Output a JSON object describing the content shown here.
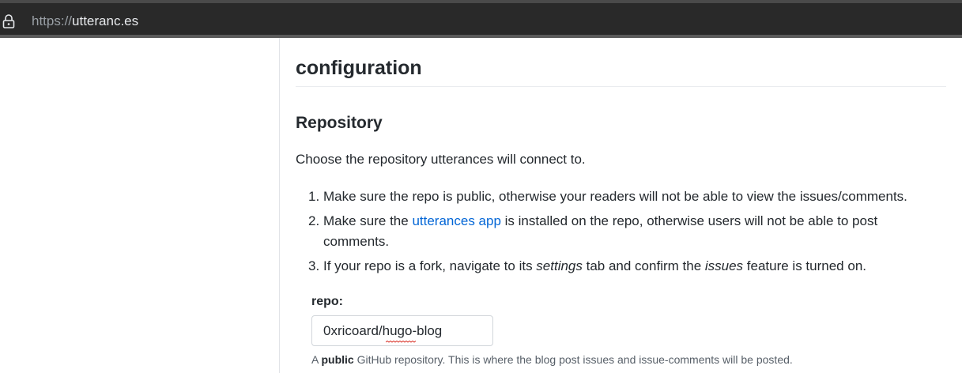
{
  "browser": {
    "url_scheme": "https://",
    "url_host": "utteranc.es"
  },
  "page": {
    "title": "configuration",
    "section_title": "Repository",
    "intro": "Choose the repository utterances will connect to.",
    "steps": [
      {
        "number": "1.",
        "text": "Make sure the repo is public, otherwise your readers will not be able to view the issues/comments."
      },
      {
        "number": "2.",
        "before": "Make sure the ",
        "link": "utterances app",
        "after": " is installed on the repo, otherwise users will not be able to post comments."
      },
      {
        "number": "3.",
        "before": "If your repo is a fork, navigate to its ",
        "em1": "settings",
        "middle": " tab and confirm the ",
        "em2": "issues",
        "after": " feature is turned on."
      }
    ],
    "repo_field": {
      "label": "repo:",
      "value": "0xricoard/hugo-blog"
    },
    "note": {
      "prefix": "A ",
      "bold": "public",
      "suffix": " GitHub repository. This is where the blog post issues and issue-comments will be posted."
    }
  },
  "colors": {
    "link": "#0366d6",
    "address_bar": "#292929",
    "text": "#24292e",
    "muted": "#586069"
  },
  "icons": [
    "lock-icon"
  ]
}
